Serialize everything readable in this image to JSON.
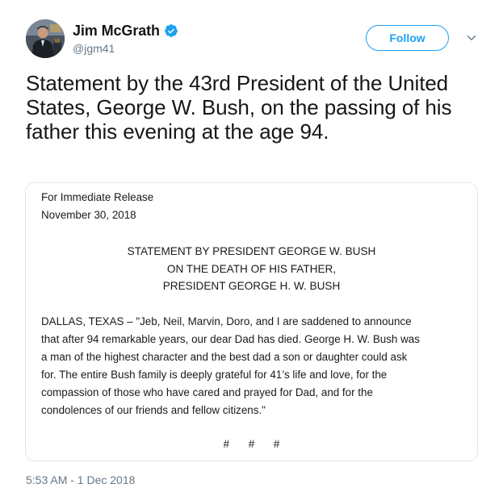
{
  "author": {
    "display_name": "Jim McGrath",
    "handle": "@jgm41",
    "verified": true,
    "avatar_icon": "profile-photo"
  },
  "actions": {
    "follow_label": "Follow",
    "more_icon": "chevron-down-icon"
  },
  "tweet": {
    "text": "Statement by the 43rd President of the United States, George W. Bush, on the passing of his father this evening at the age 94.",
    "timestamp": "5:53 AM - 1 Dec 2018"
  },
  "document": {
    "release": "For Immediate Release",
    "date": "November 30, 2018",
    "heading": [
      "STATEMENT BY PRESIDENT GEORGE W. BUSH",
      "ON THE DEATH OF HIS FATHER,",
      "PRESIDENT GEORGE H. W. BUSH"
    ],
    "body_lines": [
      "DALLAS, TEXAS – \"Jeb, Neil, Marvin, Doro, and I are saddened to announce",
      "that after 94 remarkable years, our dear Dad has died. George H. W. Bush was",
      "a man of the highest character and the best dad a son or daughter could ask",
      "for. The entire Bush family is deeply grateful for 41’s life and love, for the",
      "compassion of those who have cared and prayed for Dad, and for the",
      "condolences of our friends and fellow citizens.\""
    ],
    "end_mark": "# # #"
  },
  "colors": {
    "accent": "#1da1f2",
    "secondary_text": "#657786",
    "primary_text": "#14171a",
    "border": "#e1e8ed"
  }
}
